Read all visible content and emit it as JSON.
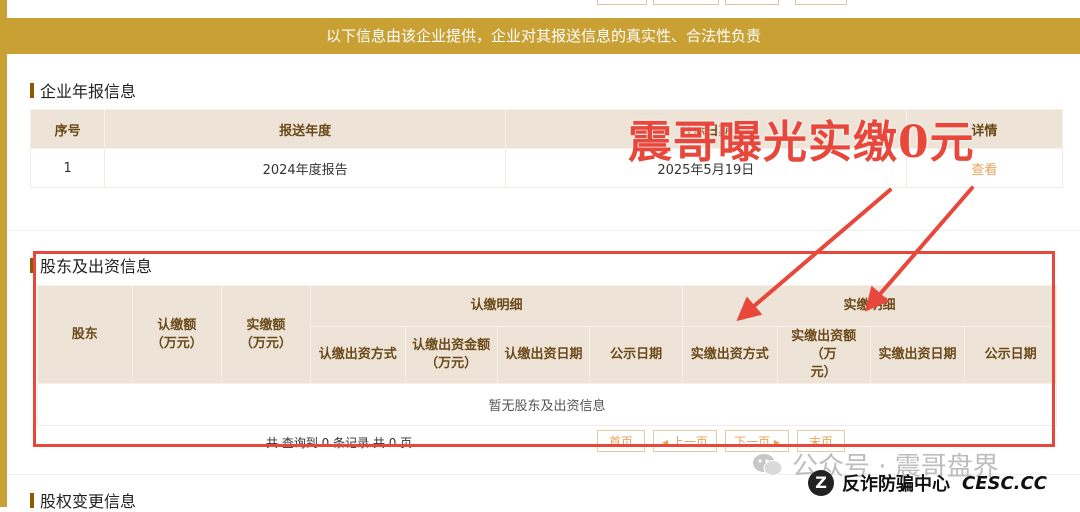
{
  "banner": {
    "text": "以下信息由该企业提供，企业对其报送信息的真实性、合法性负责"
  },
  "annual_report": {
    "title": "企业年报信息",
    "headers": [
      "序号",
      "报送年度",
      "公示日期",
      "详情"
    ],
    "rows": [
      {
        "index": "1",
        "year": "2024年度报告",
        "date": "2025年5月19日",
        "action": "查看"
      }
    ]
  },
  "shareholders": {
    "title": "股东及出资信息",
    "headers": {
      "shareholder": "股东",
      "subscribed_amount": "认缴额\n（万元）",
      "paid_amount": "实缴额\n（万元）",
      "subscribed_detail": "认缴明细",
      "paid_detail": "实缴明细",
      "sub_cols": [
        "认缴出资方式",
        "认缴出资金额\n（万元）",
        "认缴出资日期",
        "公示日期"
      ],
      "paid_cols": [
        "实缴出资方式",
        "实缴出资额（万\n元）",
        "实缴出资日期",
        "公示日期"
      ]
    },
    "empty_text": "暂无股东及出资信息",
    "pager": {
      "summary": "共 查询到 0 条记录 共 0 页",
      "first": "首页",
      "prev": "◂ 上一页",
      "next": "下一页 ▸",
      "last": "末页"
    }
  },
  "equity_change": {
    "title": "股权变更信息"
  },
  "overlay": {
    "title": "震哥曝光实缴0元"
  },
  "watermark": {
    "text": "公众号 · 震哥盘界"
  },
  "brand": {
    "logo": "Z",
    "name": "反诈防骗中心",
    "site": "CESC.CC"
  },
  "colors": {
    "accent": "#c9a034",
    "header_bg": "#ede3d6",
    "highlight": "#e8483c",
    "link": "#e7a35a"
  }
}
